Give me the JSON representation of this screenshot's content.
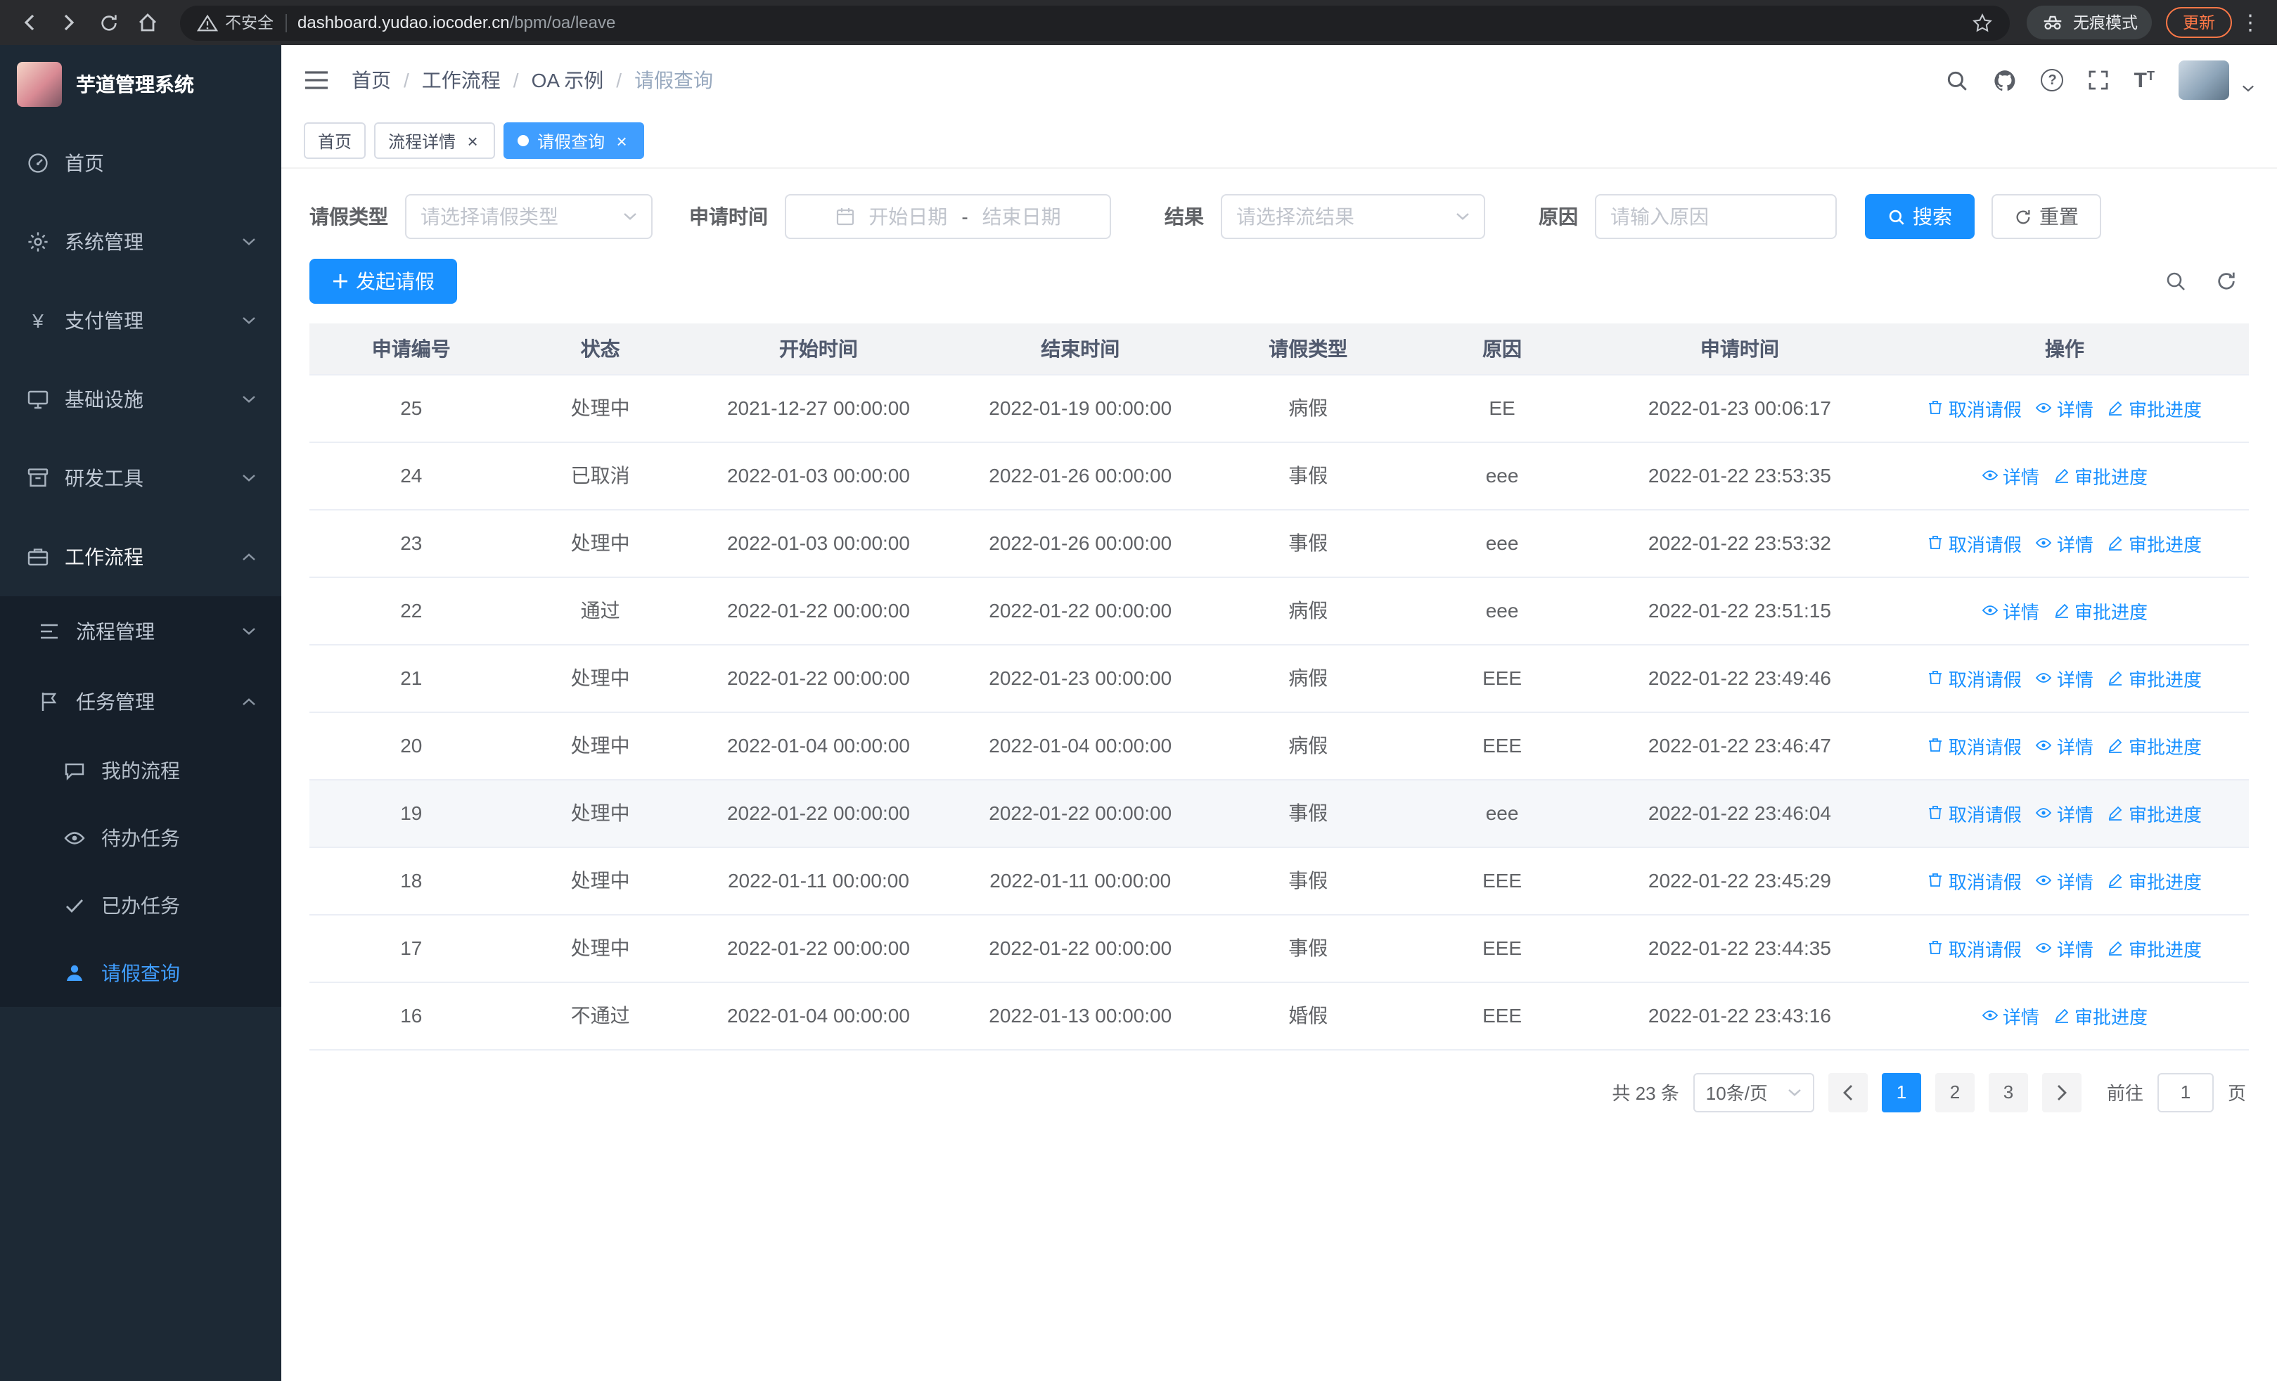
{
  "browser": {
    "warning": "不安全",
    "url_host": "dashboard.yudao.iocoder.cn",
    "url_path": "/bpm/oa/leave",
    "incognito": "无痕模式",
    "update": "更新"
  },
  "icons": {
    "close": "×",
    "help": "?",
    "yen": "¥",
    "dots": "⋮",
    "fontsize": "T"
  },
  "sidebar": {
    "title": "芋道管理系统",
    "menu": [
      {
        "label": "首页"
      },
      {
        "label": "系统管理"
      },
      {
        "label": "支付管理"
      },
      {
        "label": "基础设施"
      },
      {
        "label": "研发工具"
      },
      {
        "label": "工作流程"
      }
    ],
    "submenu": {
      "process": "流程管理",
      "task": "任务管理",
      "my_process": "我的流程",
      "todo": "待办任务",
      "done": "已办任务",
      "leave": "请假查询"
    }
  },
  "header": {
    "breadcrumb": [
      "首页",
      "工作流程",
      "OA 示例",
      "请假查询"
    ],
    "separator": "/"
  },
  "tabs": [
    {
      "label": "首页"
    },
    {
      "label": "流程详情"
    },
    {
      "label": "请假查询"
    }
  ],
  "filters": {
    "leave_type_label": "请假类型",
    "leave_type_placeholder": "请选择请假类型",
    "apply_time_label": "申请时间",
    "start_placeholder": "开始日期",
    "range_separator": "-",
    "end_placeholder": "结束日期",
    "result_label": "结果",
    "result_placeholder": "请选择流结果",
    "reason_label": "原因",
    "reason_placeholder": "请输入原因",
    "search": "搜索",
    "reset": "重置"
  },
  "toolbar": {
    "create": "发起请假"
  },
  "table": {
    "headers": [
      "申请编号",
      "状态",
      "开始时间",
      "结束时间",
      "请假类型",
      "原因",
      "申请时间",
      "操作"
    ],
    "actions": {
      "cancel": "取消请假",
      "detail": "详情",
      "progress": "审批进度"
    },
    "rows": [
      {
        "id": "25",
        "status": "处理中",
        "start": "2021-12-27 00:00:00",
        "end": "2022-01-19 00:00:00",
        "type": "病假",
        "reason": "EE",
        "apply_time": "2022-01-23 00:06:17"
      },
      {
        "id": "24",
        "status": "已取消",
        "start": "2022-01-03 00:00:00",
        "end": "2022-01-26 00:00:00",
        "type": "事假",
        "reason": "eee",
        "apply_time": "2022-01-22 23:53:35"
      },
      {
        "id": "23",
        "status": "处理中",
        "start": "2022-01-03 00:00:00",
        "end": "2022-01-26 00:00:00",
        "type": "事假",
        "reason": "eee",
        "apply_time": "2022-01-22 23:53:32"
      },
      {
        "id": "22",
        "status": "通过",
        "start": "2022-01-22 00:00:00",
        "end": "2022-01-22 00:00:00",
        "type": "病假",
        "reason": "eee",
        "apply_time": "2022-01-22 23:51:15"
      },
      {
        "id": "21",
        "status": "处理中",
        "start": "2022-01-22 00:00:00",
        "end": "2022-01-23 00:00:00",
        "type": "病假",
        "reason": "EEE",
        "apply_time": "2022-01-22 23:49:46"
      },
      {
        "id": "20",
        "status": "处理中",
        "start": "2022-01-04 00:00:00",
        "end": "2022-01-04 00:00:00",
        "type": "病假",
        "reason": "EEE",
        "apply_time": "2022-01-22 23:46:47"
      },
      {
        "id": "19",
        "status": "处理中",
        "start": "2022-01-22 00:00:00",
        "end": "2022-01-22 00:00:00",
        "type": "事假",
        "reason": "eee",
        "apply_time": "2022-01-22 23:46:04"
      },
      {
        "id": "18",
        "status": "处理中",
        "start": "2022-01-11 00:00:00",
        "end": "2022-01-11 00:00:00",
        "type": "事假",
        "reason": "EEE",
        "apply_time": "2022-01-22 23:45:29"
      },
      {
        "id": "17",
        "status": "处理中",
        "start": "2022-01-22 00:00:00",
        "end": "2022-01-22 00:00:00",
        "type": "事假",
        "reason": "EEE",
        "apply_time": "2022-01-22 23:44:35"
      },
      {
        "id": "16",
        "status": "不通过",
        "start": "2022-01-04 00:00:00",
        "end": "2022-01-13 00:00:00",
        "type": "婚假",
        "reason": "EEE",
        "apply_time": "2022-01-22 23:43:16"
      }
    ]
  },
  "pagination": {
    "total": "共 23 条",
    "page_size": "10条/页",
    "pages": [
      "1",
      "2",
      "3"
    ],
    "active_page": "1",
    "goto_label": "前往",
    "goto_value": "1",
    "unit": "页"
  },
  "colors": {
    "primary": "#1890ff",
    "active_tab": "#409eff",
    "link": "#1890ff",
    "sidebar_bg": "#1d2935",
    "submenu_bg": "#161f2a",
    "table_header_bg": "#f2f3f5"
  }
}
